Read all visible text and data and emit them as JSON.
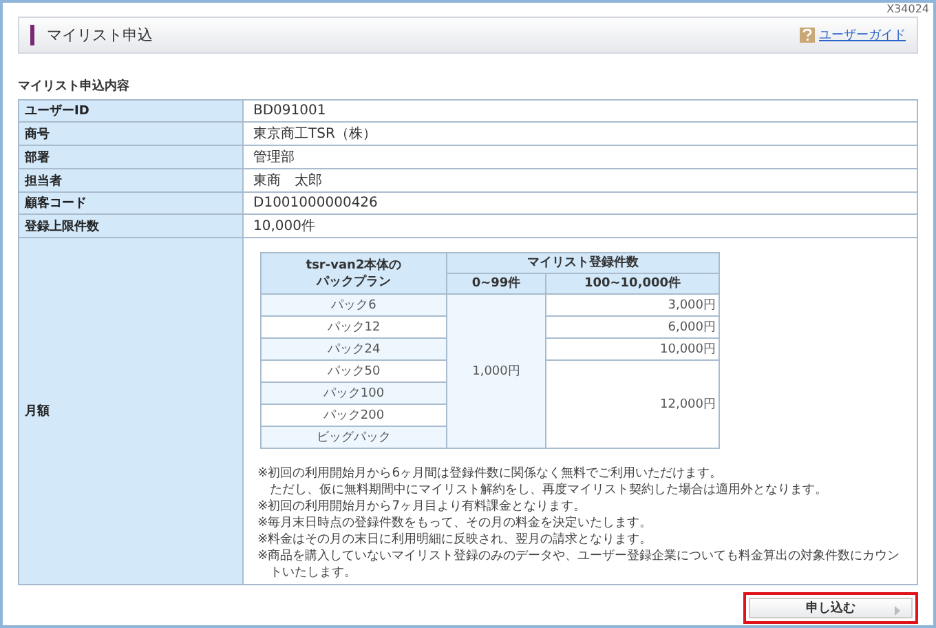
{
  "page_code": "X34024",
  "header": {
    "title": "マイリスト申込",
    "guide_link": "ユーザーガイド"
  },
  "section_title": "マイリスト申込内容",
  "fields": [
    {
      "label": "ユーザーID",
      "value": "BD091001"
    },
    {
      "label": "商号",
      "value": "東京商工TSR（株）"
    },
    {
      "label": "部署",
      "value": "管理部"
    },
    {
      "label": "担当者",
      "value": "東商　太郎"
    },
    {
      "label": "顧客コード",
      "value": "D1001000000426"
    },
    {
      "label": "登録上限件数",
      "value": "10,000件"
    }
  ],
  "monthly": {
    "label": "月額",
    "pricing": {
      "plan_header": [
        "tsr-van2本体の",
        "パックプラン"
      ],
      "count_header": "マイリスト登録件数",
      "tiers": [
        "0~99件",
        "100~10,000件"
      ],
      "low_tier_price": "1,000円",
      "high_tier_groups": [
        {
          "price": "3,000円",
          "plans": [
            "パック6"
          ]
        },
        {
          "price": "6,000円",
          "plans": [
            "パック12"
          ]
        },
        {
          "price": "10,000円",
          "plans": [
            "パック24"
          ]
        },
        {
          "price": "12,000円",
          "plans": [
            "パック50",
            "パック100",
            "パック200",
            "ビッグパック"
          ]
        }
      ]
    },
    "notes": [
      {
        "lines": [
          "※初回の利用開始月から6ヶ月間は登録件数に関係なく無料でご利用いただけます。",
          "ただし、仮に無料期間中にマイリスト解約をし、再度マイリスト契約した場合は適用外となります。"
        ]
      },
      {
        "lines": [
          "※初回の利用開始月から7ヶ月目より有料課金となります。"
        ]
      },
      {
        "lines": [
          "※毎月末日時点の登録件数をもって、その月の料金を決定いたします。"
        ]
      },
      {
        "lines": [
          "※料金はその月の末日に利用明細に反映され、翌月の請求となります。"
        ]
      },
      {
        "lines": [
          "※商品を購入していないマイリスト登録のみのデータや、ユーザー登録企業についても料金算出の対象件数にカウントいたします。"
        ]
      }
    ]
  },
  "apply_button": {
    "label": "申し込む",
    "highlighted": true
  }
}
